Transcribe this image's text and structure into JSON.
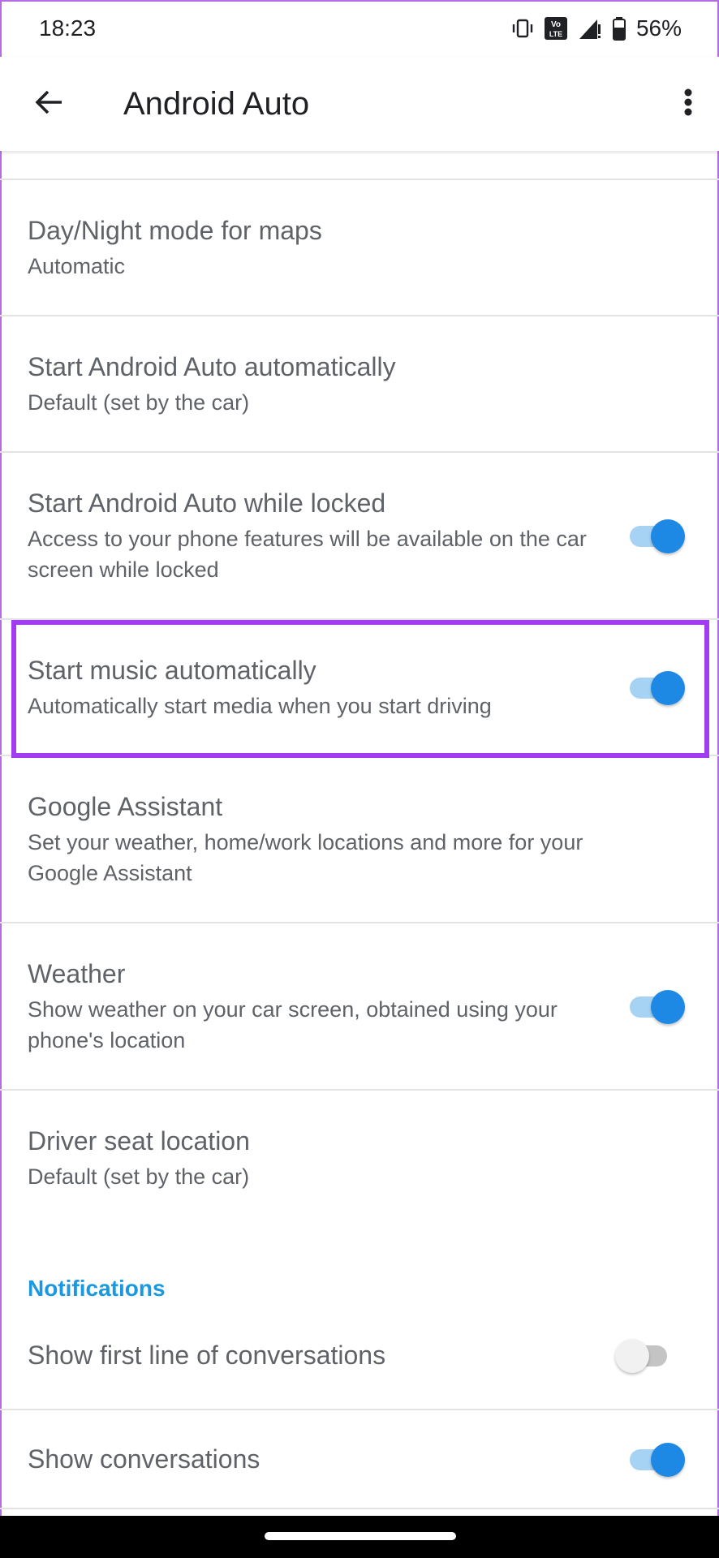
{
  "status_bar": {
    "time": "18:23",
    "battery": "56%",
    "icons": [
      "vibrate-icon",
      "volte-icon",
      "signal-icon",
      "battery-icon"
    ]
  },
  "app_bar": {
    "title": "Android Auto",
    "back_icon": "arrow-left-icon",
    "more_icon": "more-vert-icon"
  },
  "settings": {
    "day_night": {
      "title": "Day/Night mode for maps",
      "subtitle": "Automatic"
    },
    "start_auto": {
      "title": "Start Android Auto automatically",
      "subtitle": "Default (set by the car)"
    },
    "start_locked": {
      "title": "Start Android Auto while locked",
      "subtitle": "Access to your phone features will be available on the car screen while locked",
      "enabled": true
    },
    "start_music": {
      "title": "Start music automatically",
      "subtitle": "Automatically start media when you start driving",
      "enabled": true
    },
    "assistant": {
      "title": "Google Assistant",
      "subtitle": "Set your weather, home/work locations and more for your Google Assistant"
    },
    "weather": {
      "title": "Weather",
      "subtitle": "Show weather on your car screen, obtained using your phone's location",
      "enabled": true
    },
    "driver_seat": {
      "title": "Driver seat location",
      "subtitle": "Default (set by the car)"
    }
  },
  "notifications": {
    "header": "Notifications",
    "first_line": {
      "title": "Show first line of conversations",
      "enabled": false
    },
    "conversations": {
      "title": "Show conversations",
      "enabled": true
    }
  },
  "colors": {
    "accent": "#1e88e5",
    "section_header": "#1a98e0",
    "highlight": "#a23cf0"
  }
}
